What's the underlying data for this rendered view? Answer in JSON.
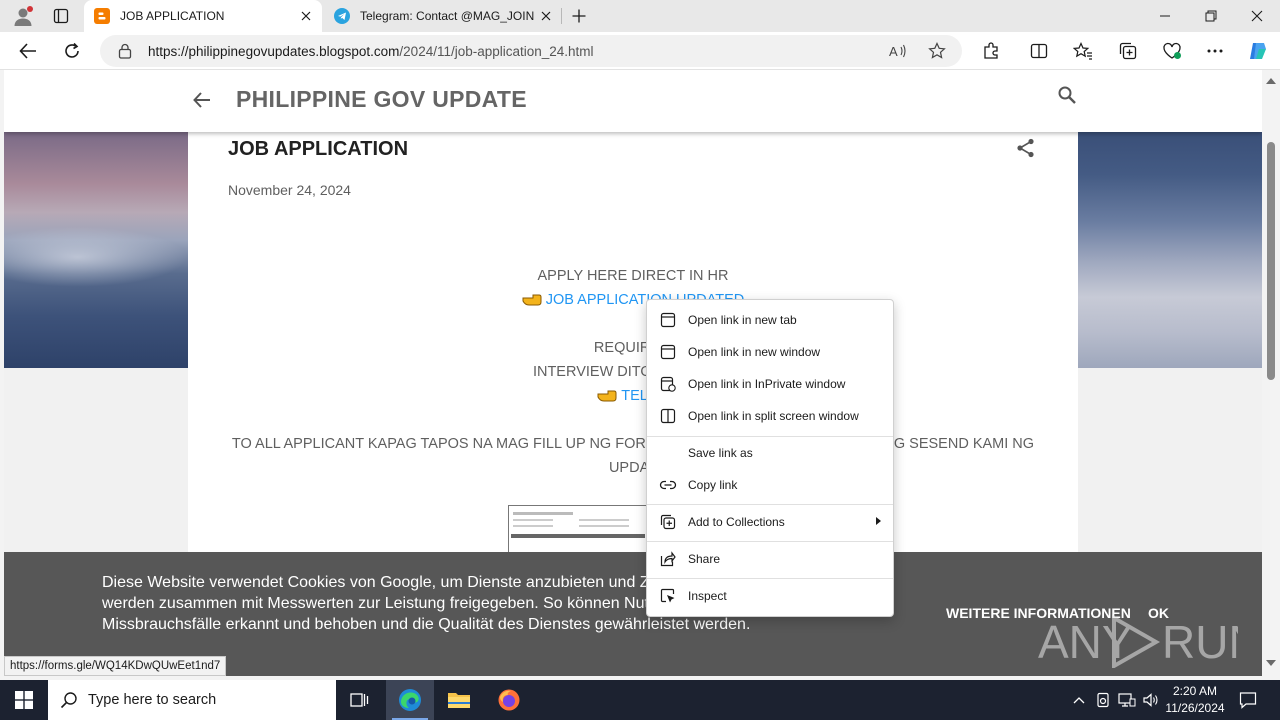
{
  "browser": {
    "tabs": [
      {
        "title": "JOB APPLICATION",
        "favicon": "blogger-icon",
        "active": true
      },
      {
        "title": "Telegram: Contact @MAG_JOIN_",
        "favicon": "telegram-icon",
        "active": false
      }
    ],
    "address": {
      "host": "https://philippinegovupdates.blogspot.com",
      "path": "/2024/11/job-application_24.html"
    },
    "status_url": "https://forms.gle/WQ14KDwQUwEet1nd7"
  },
  "blog": {
    "title": "PHILIPPINE GOV UPDATE",
    "post": {
      "title": "JOB APPLICATION",
      "date": "November 24, 2024",
      "line1": "APPLY HERE DIRECT IN HR",
      "link1": "JOB APPLICATION UPDATED",
      "line2": "REQUIREM",
      "line3": "INTERVIEW DITO SUMALI SA",
      "link2": "TELEG",
      "line4_left": "TO ALL APPLICANT KAPAG TAPOS NA MAG FILL UP NG FOR",
      "line4_right": "G SESEND KAMI NG",
      "line5": "UPDAT"
    }
  },
  "cookie_banner": {
    "message": "Diese Website verwendet Cookies von Google, um Dienste anzubieten und Zu Adresse und dein User-Agent werden zusammen mit Messwerten zur Leistung freigegeben. So können Nutzungsstatistiken generiert, Missbrauchsfälle erkannt und behoben und die Qualität des Dienstes gewährleistet werden.",
    "more_label": "WEITERE INFORMATIONEN",
    "ok_label": "OK"
  },
  "watermark": "ANY RUN",
  "context_menu": {
    "items": [
      {
        "label": "Open link in new tab",
        "icon": "new-tab-icon"
      },
      {
        "label": "Open link in new window",
        "icon": "new-window-icon"
      },
      {
        "label": "Open link in InPrivate window",
        "icon": "inprivate-icon"
      },
      {
        "label": "Open link in split screen window",
        "icon": "split-screen-icon"
      },
      {
        "label": "Save link as",
        "icon": ""
      },
      {
        "label": "Copy link",
        "icon": "link-icon"
      },
      {
        "label": "Add to Collections",
        "icon": "collections-icon",
        "submenu": true
      },
      {
        "label": "Share",
        "icon": "share-icon"
      },
      {
        "label": "Inspect",
        "icon": "inspect-icon"
      }
    ]
  },
  "taskbar": {
    "search_placeholder": "Type here to search",
    "time": "2:20 AM",
    "date": "11/26/2024"
  }
}
